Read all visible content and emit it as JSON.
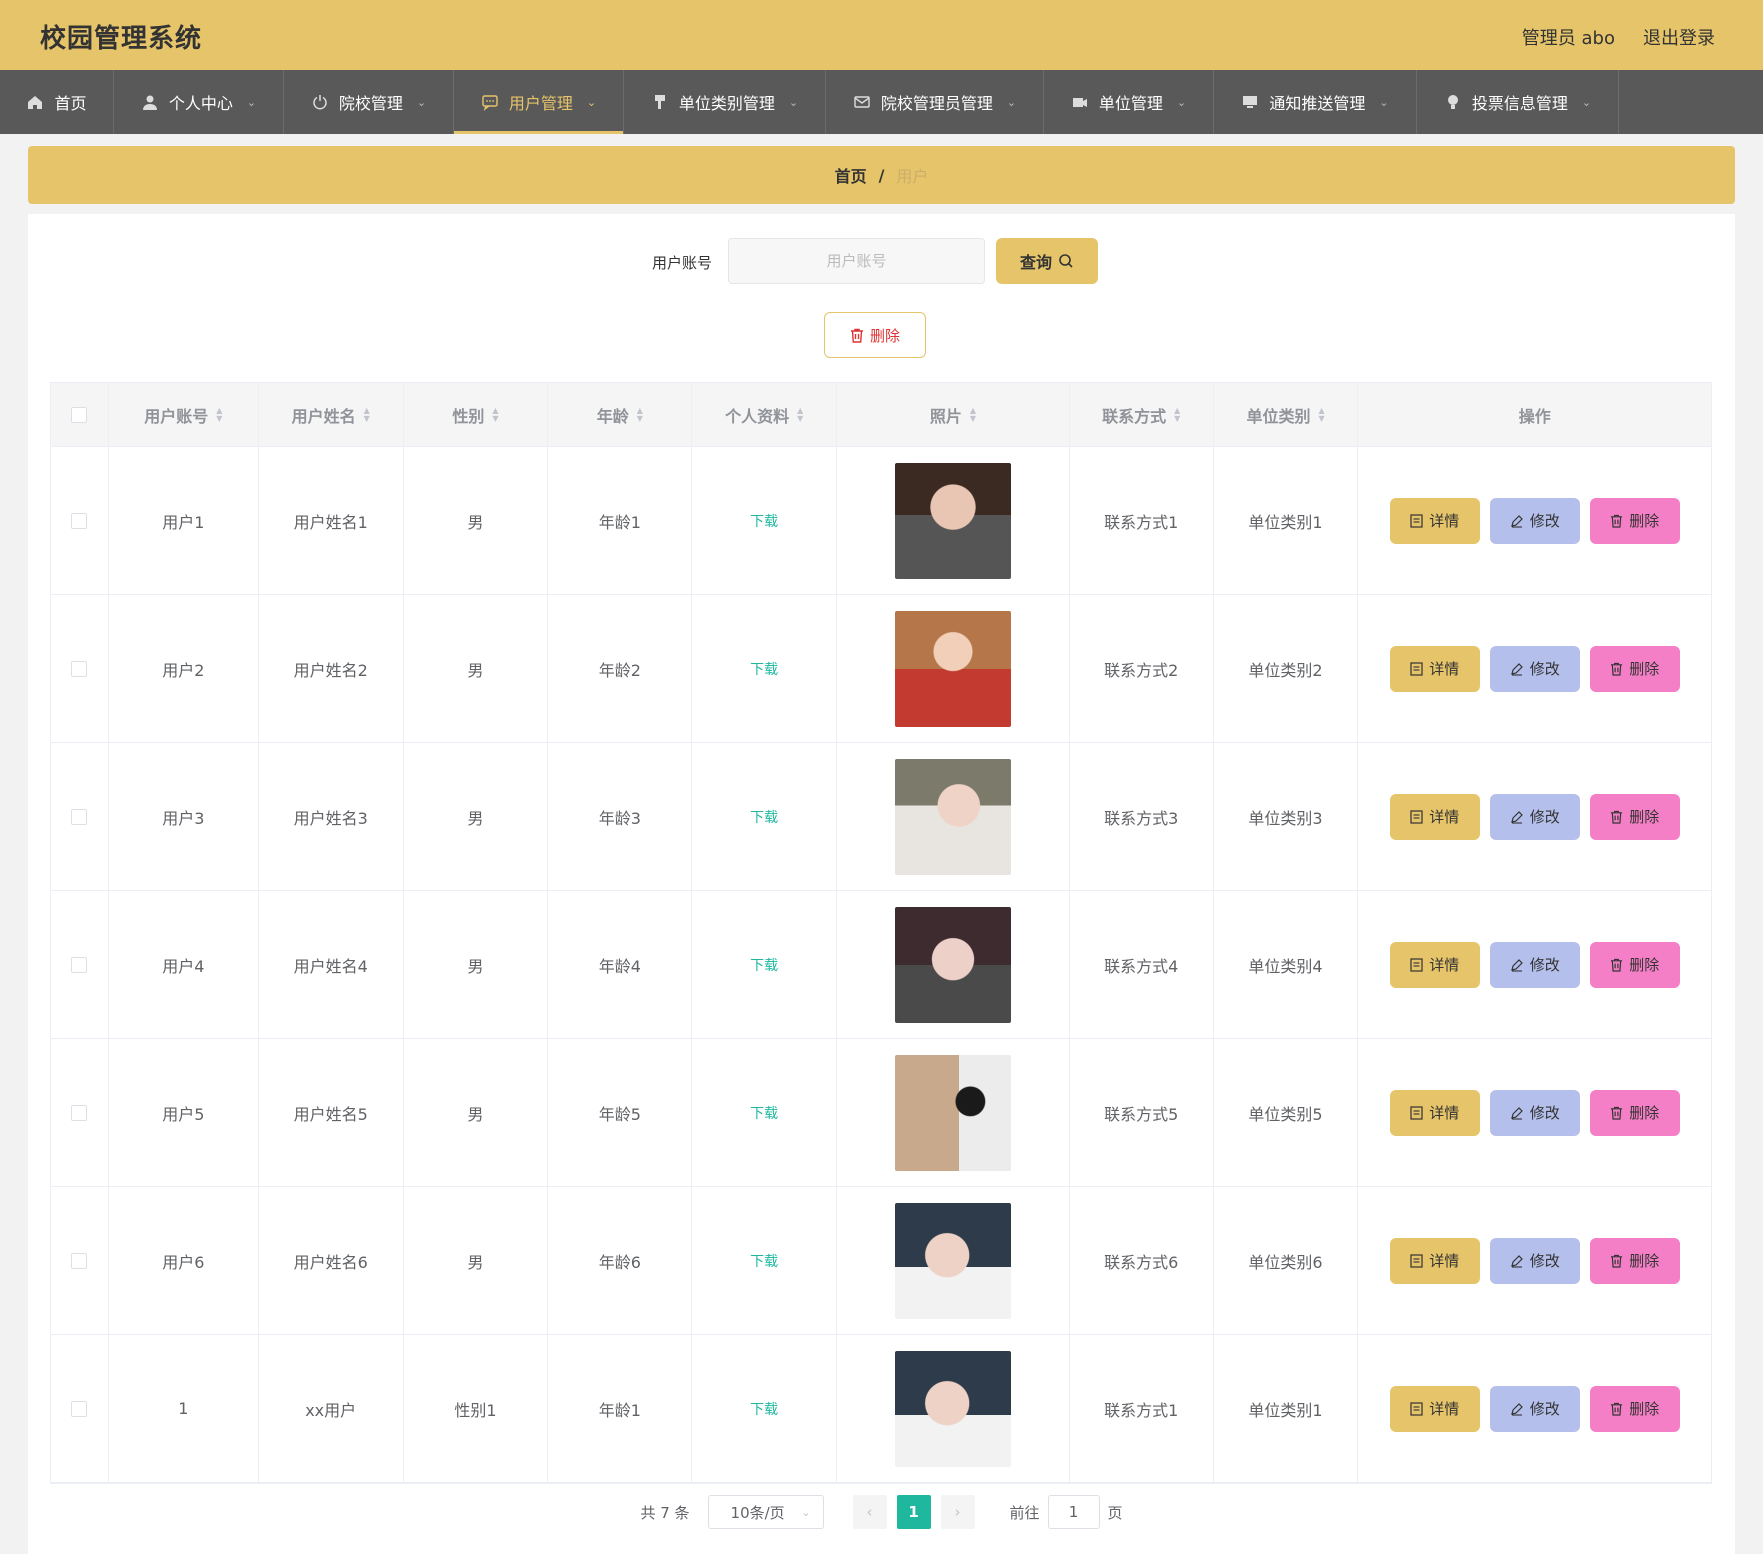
{
  "header": {
    "title": "校园管理系统",
    "user_label": "管理员 abo",
    "logout_label": "退出登录"
  },
  "nav": [
    {
      "label": "首页",
      "icon": "home-icon",
      "has_dropdown": false,
      "active": false
    },
    {
      "label": "个人中心",
      "icon": "person-icon",
      "has_dropdown": true,
      "active": false
    },
    {
      "label": "院校管理",
      "icon": "power-icon",
      "has_dropdown": true,
      "active": false
    },
    {
      "label": "用户管理",
      "icon": "chat-icon",
      "has_dropdown": true,
      "active": true
    },
    {
      "label": "单位类别管理",
      "icon": "brush-icon",
      "has_dropdown": true,
      "active": false
    },
    {
      "label": "院校管理员管理",
      "icon": "mail-icon",
      "has_dropdown": true,
      "active": false
    },
    {
      "label": "单位管理",
      "icon": "film-icon",
      "has_dropdown": true,
      "active": false
    },
    {
      "label": "通知推送管理",
      "icon": "monitor-icon",
      "has_dropdown": true,
      "active": false
    },
    {
      "label": "投票信息管理",
      "icon": "bulb-icon",
      "has_dropdown": true,
      "active": false
    }
  ],
  "breadcrumb": {
    "home": "首页",
    "separator": "/",
    "current": "用户"
  },
  "search": {
    "label": "用户账号",
    "placeholder": "用户账号",
    "value": "",
    "query_label": "查询",
    "delete_label": "删除"
  },
  "table": {
    "columns": [
      "用户账号",
      "用户姓名",
      "性别",
      "年龄",
      "个人资料",
      "照片",
      "联系方式",
      "单位类别",
      "操作"
    ],
    "rows": [
      {
        "account": "用户1",
        "name": "用户姓名1",
        "gender": "男",
        "age": "年龄1",
        "profile": "下载",
        "phone": "联系方式1",
        "category": "单位类别1"
      },
      {
        "account": "用户2",
        "name": "用户姓名2",
        "gender": "男",
        "age": "年龄2",
        "profile": "下载",
        "phone": "联系方式2",
        "category": "单位类别2"
      },
      {
        "account": "用户3",
        "name": "用户姓名3",
        "gender": "男",
        "age": "年龄3",
        "profile": "下载",
        "phone": "联系方式3",
        "category": "单位类别3"
      },
      {
        "account": "用户4",
        "name": "用户姓名4",
        "gender": "男",
        "age": "年龄4",
        "profile": "下载",
        "phone": "联系方式4",
        "category": "单位类别4"
      },
      {
        "account": "用户5",
        "name": "用户姓名5",
        "gender": "男",
        "age": "年龄5",
        "profile": "下载",
        "phone": "联系方式5",
        "category": "单位类别5"
      },
      {
        "account": "用户6",
        "name": "用户姓名6",
        "gender": "男",
        "age": "年龄6",
        "profile": "下载",
        "phone": "联系方式6",
        "category": "单位类别6"
      },
      {
        "account": "1",
        "name": "xx用户",
        "gender": "性别1",
        "age": "年龄1",
        "profile": "下载",
        "phone": "联系方式1",
        "category": "单位类别1"
      }
    ],
    "actions": {
      "detail": "详情",
      "edit": "修改",
      "delete": "删除"
    }
  },
  "pagination": {
    "total": "共 7 条",
    "page_size": "10条/页",
    "current_page": "1",
    "goto_prefix": "前往",
    "goto_value": "1",
    "goto_suffix": "页"
  },
  "colors": {
    "accent": "#e6c46a",
    "nav_bg": "#595959",
    "edit": "#b4bfec",
    "delete": "#f47fc6",
    "link": "#1fb89e"
  }
}
